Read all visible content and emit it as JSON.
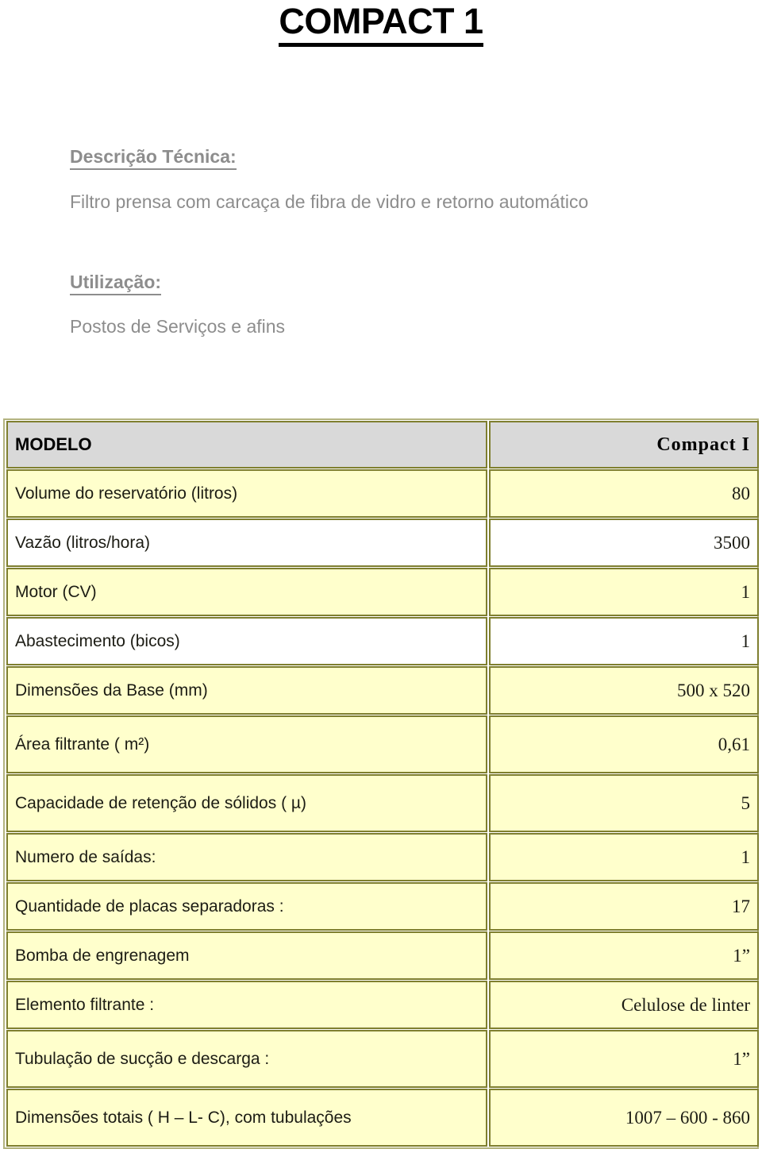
{
  "title": "COMPACT 1",
  "sections": [
    {
      "heading": "Descrição Técnica:",
      "body": "Filtro prensa com carcaça de fibra de vidro e retorno automático"
    },
    {
      "heading": "Utilização:",
      "body": "Postos de Serviços e afins"
    }
  ],
  "spec_table": {
    "header": {
      "label": "MODELO",
      "value": "Compact  I"
    },
    "rows": [
      {
        "label": "Volume do reservatório (litros)",
        "value": "80"
      },
      {
        "label": "Vazão (litros/hora)",
        "value": "3500"
      },
      {
        "label": "Motor (CV)",
        "value": "1"
      },
      {
        "label": "Abastecimento (bicos)",
        "value": "1"
      },
      {
        "label": "Dimensões da Base (mm)",
        "value": "500 x 520"
      },
      {
        "label": "Área filtrante  ( m²)",
        "value": "0,61"
      },
      {
        "label": "Capacidade de retenção de  sólidos ( µ)",
        "value": "5"
      },
      {
        "label": "Numero de saídas:",
        "value": "1"
      },
      {
        "label": "Quantidade de placas separadoras :",
        "value": "17"
      },
      {
        "label": "Bomba de engrenagem",
        "value": "1”"
      },
      {
        "label": "Elemento filtrante :",
        "value": "Celulose de linter"
      },
      {
        "label": "Tubulação de sucção e descarga :",
        "value": "1”"
      },
      {
        "label": "Dimensões totais ( H – L- C), com tubulações",
        "value": "1007 – 600 - 860"
      }
    ]
  },
  "colors": {
    "table_border": "#7f7f2f",
    "table_outer_border": "#b3b37f",
    "row_yellow": "#ffffcc",
    "row_white": "#ffffff",
    "header_gray": "#d9d9d9",
    "heading_gray": "#8d8d8d",
    "title_black": "#000000"
  }
}
